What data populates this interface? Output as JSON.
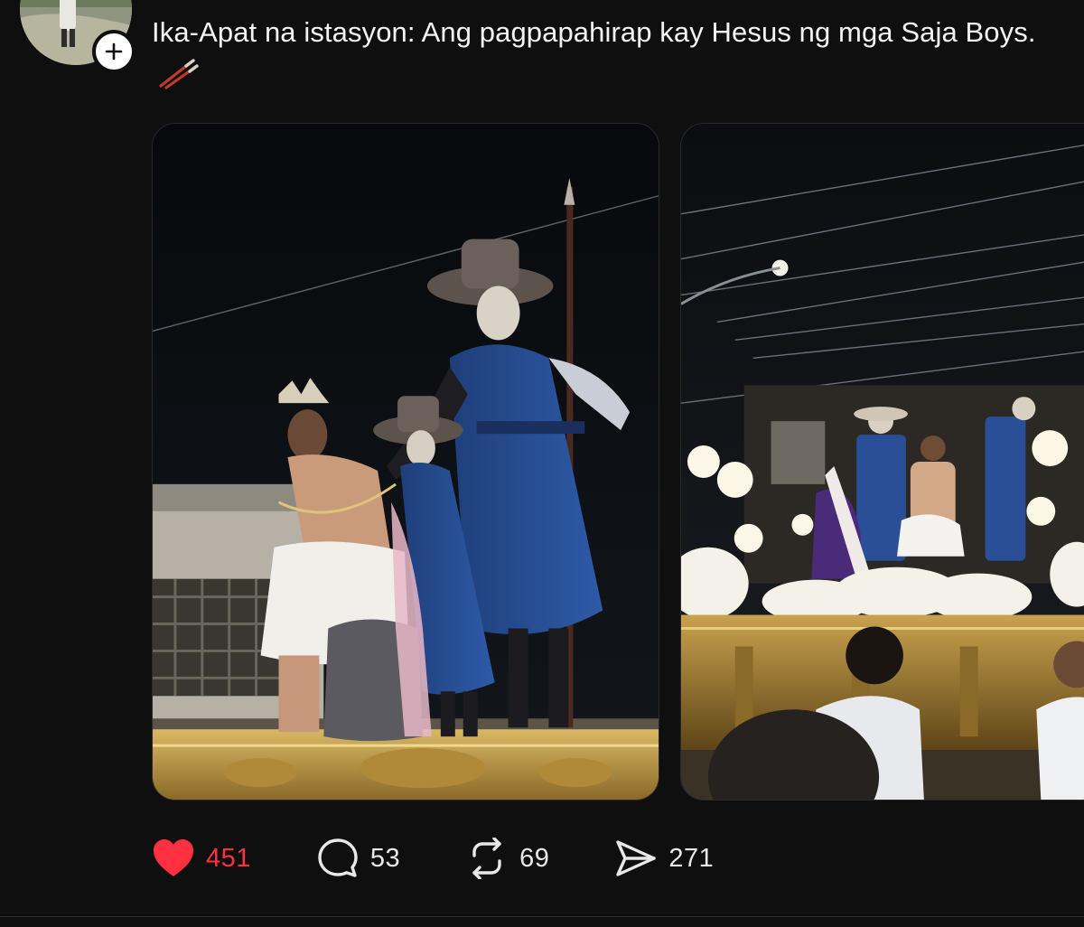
{
  "post": {
    "caption": "Ika-Apat na istasyon: Ang pagpapahirap kay Hesus ng mga Saja Boys.",
    "caption_emoji": "chopsticks-emoji",
    "follow_icon": "plus-icon",
    "images": [
      {
        "icon": "photo-procession-statues"
      },
      {
        "icon": "photo-procession-float"
      }
    ]
  },
  "actions": {
    "like": {
      "icon": "heart-icon",
      "count": "451",
      "active": true,
      "color": "#ff3040"
    },
    "comment": {
      "icon": "comment-icon",
      "count": "53"
    },
    "repost": {
      "icon": "repost-icon",
      "count": "69"
    },
    "share": {
      "icon": "send-icon",
      "count": "271"
    }
  },
  "theme": {
    "background": "#0f0f10",
    "text": "#f3f3f3",
    "like_color": "#ff3040"
  }
}
